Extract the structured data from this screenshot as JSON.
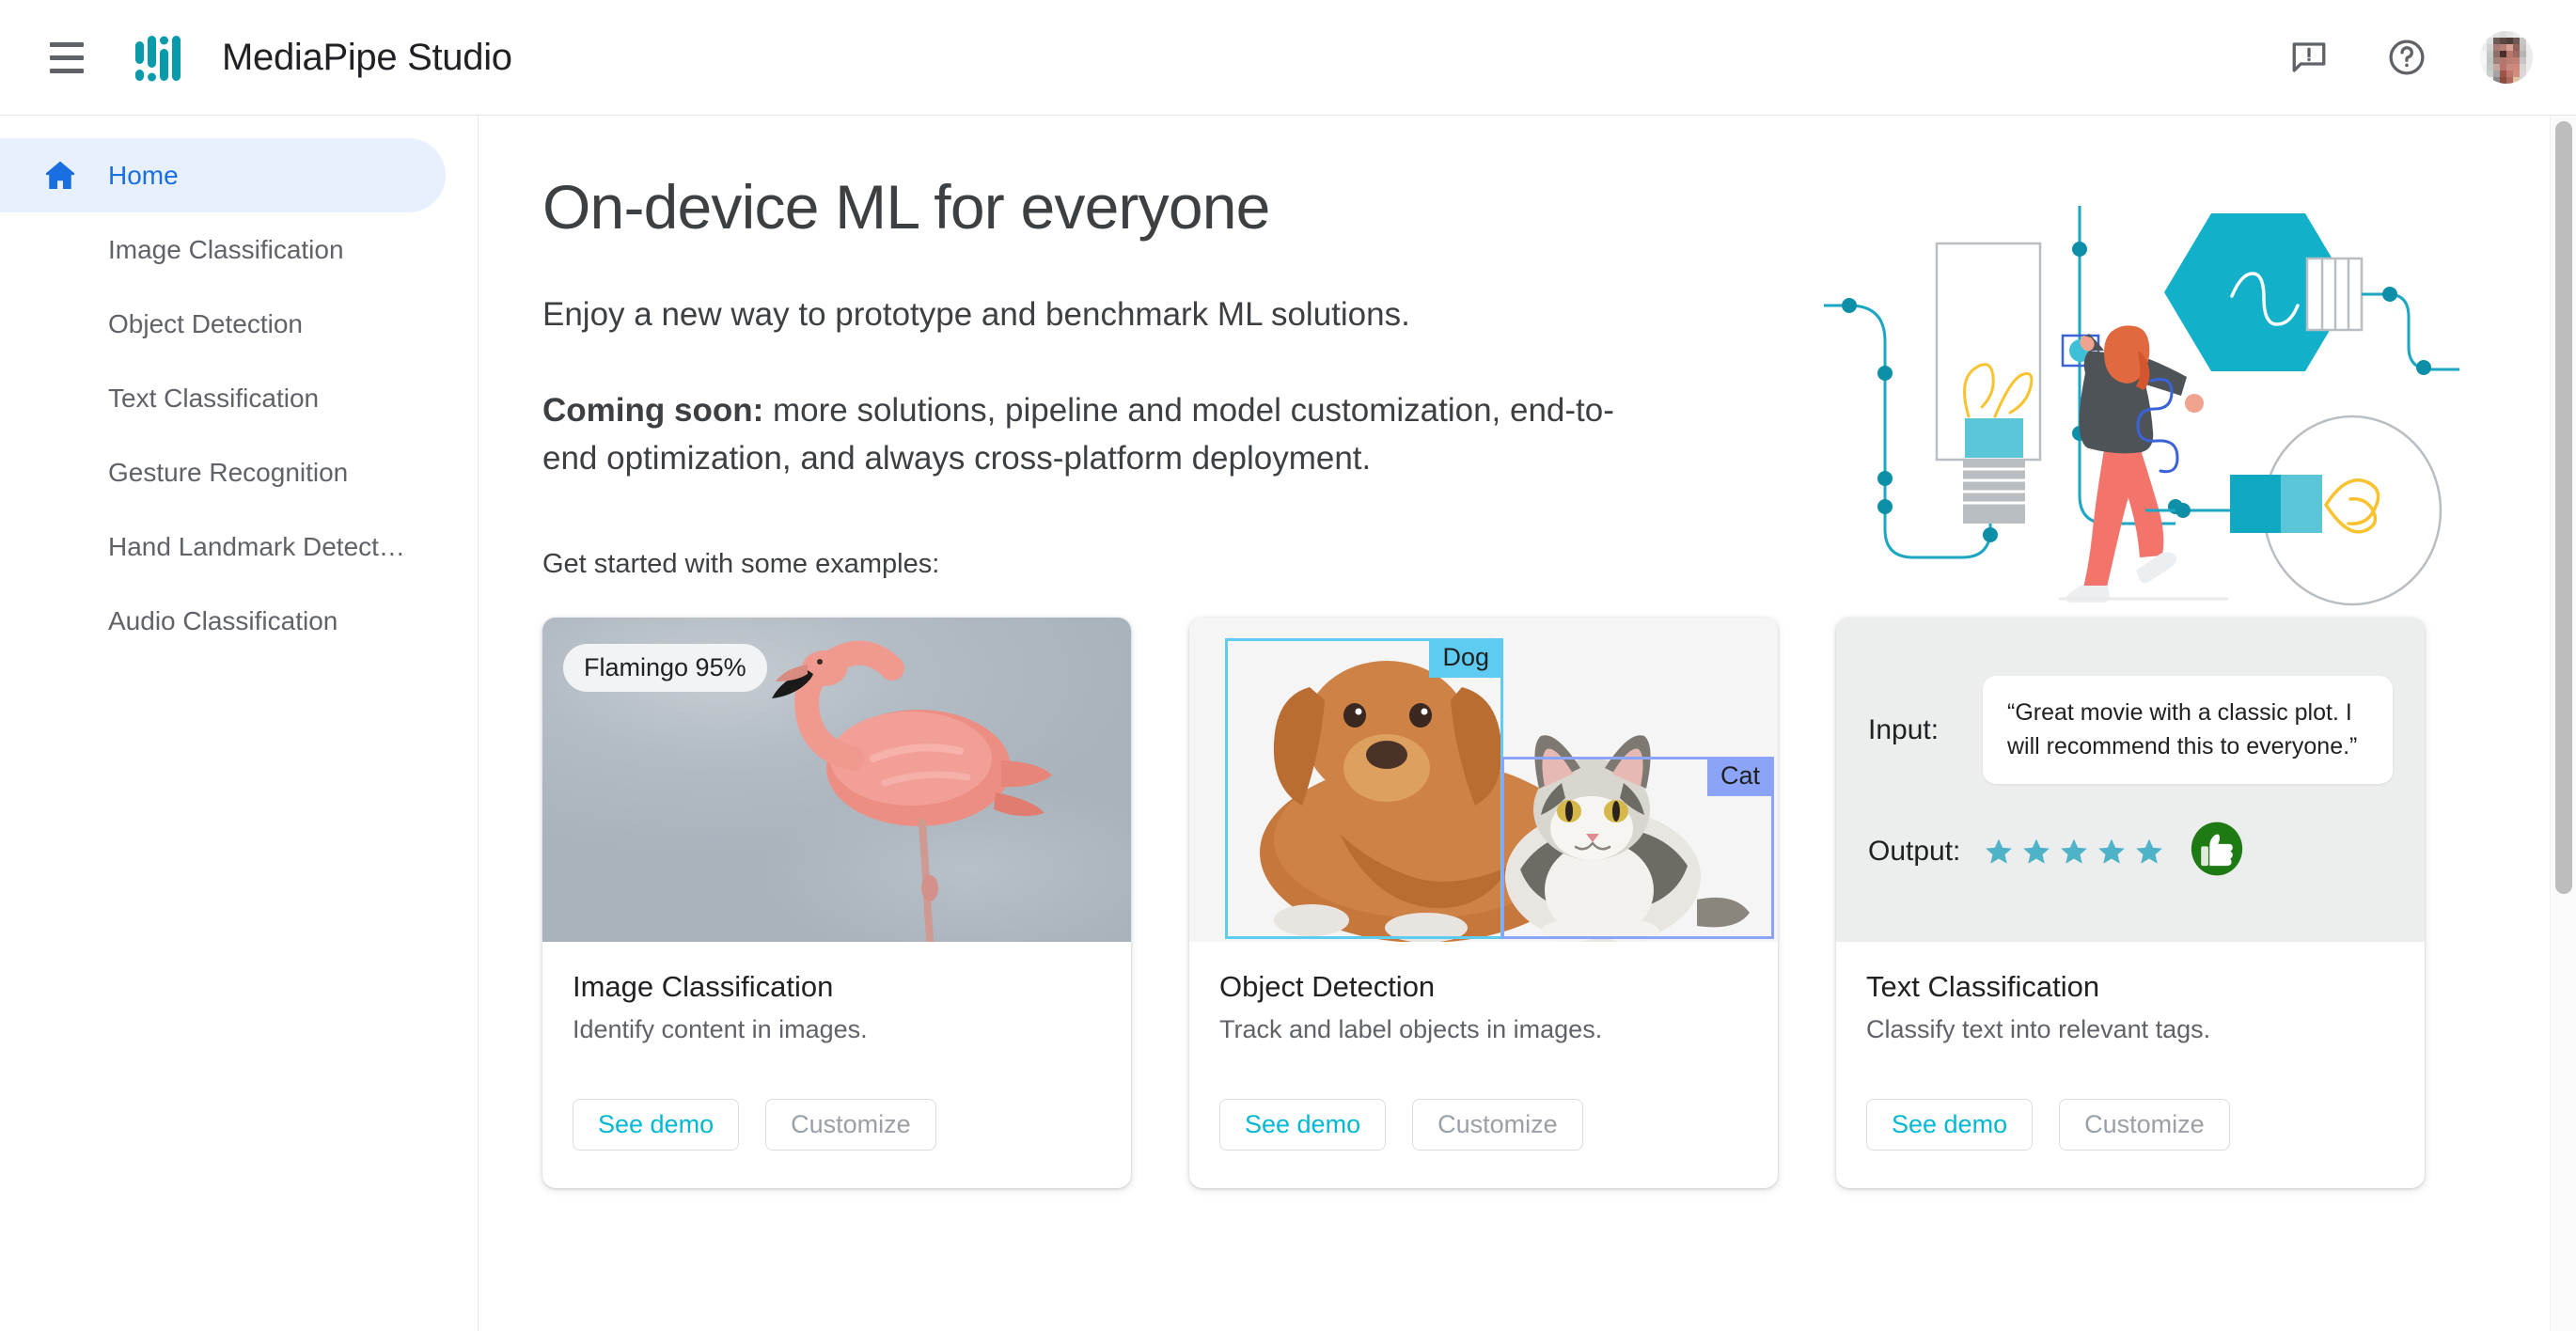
{
  "header": {
    "menu_icon": "hamburger-menu-icon",
    "logo_icon": "mediapipe-logo-icon",
    "title": "MediaPipe Studio",
    "feedback_icon": "feedback-icon",
    "help_icon": "help-icon",
    "avatar_label": "user-avatar"
  },
  "sidebar": {
    "items": [
      {
        "label": "Home",
        "icon": "home-icon",
        "active": true
      },
      {
        "label": "Image Classification",
        "icon": "",
        "active": false
      },
      {
        "label": "Object Detection",
        "icon": "",
        "active": false
      },
      {
        "label": "Text Classification",
        "icon": "",
        "active": false
      },
      {
        "label": "Gesture Recognition",
        "icon": "",
        "active": false
      },
      {
        "label": "Hand Landmark Detect…",
        "icon": "",
        "active": false
      },
      {
        "label": "Audio Classification",
        "icon": "",
        "active": false
      }
    ]
  },
  "main": {
    "heading": "On-device ML for everyone",
    "lead": "Enjoy a new way to prototype and benchmark ML solutions.",
    "coming_soon_label": "Coming soon:",
    "coming_soon_text": " more solutions, pipeline and model customization, end-to-end optimization, and always cross-platform deployment.",
    "examples_label": "Get started with some examples:"
  },
  "cards": [
    {
      "title": "Image Classification",
      "description": "Identify content in images.",
      "demo_label": "See demo",
      "customize_label": "Customize",
      "media_type": "flamingo-photo",
      "badge": "Flamingo 95%"
    },
    {
      "title": "Object Detection",
      "description": "Track and label objects in images.",
      "demo_label": "See demo",
      "customize_label": "Customize",
      "media_type": "dog-cat-photo",
      "detections": [
        {
          "label": "Dog",
          "color": "#5ecbf0"
        },
        {
          "label": "Cat",
          "color": "#8ca4f8"
        }
      ]
    },
    {
      "title": "Text Classification",
      "description": "Classify text into relevant tags.",
      "demo_label": "See demo",
      "customize_label": "Customize",
      "media_type": "text-sentiment",
      "input_label": "Input:",
      "input_text": "“Great movie with a classic plot. I will recommend this to everyone.”",
      "output_label": "Output:",
      "star_count": 5,
      "sentiment_icon": "thumbs-up-icon"
    }
  ],
  "colors": {
    "brand_teal": "#0a9bab",
    "accent_blue": "#1a6fe0",
    "nav_active_bg": "#e8f0fe",
    "demo_link": "#00b8d4",
    "disabled_text": "#9aa0a6",
    "star": "#4eb3c7",
    "thumb_green": "#1e7a12"
  },
  "scrollbar": {
    "name": "page-scrollbar"
  }
}
